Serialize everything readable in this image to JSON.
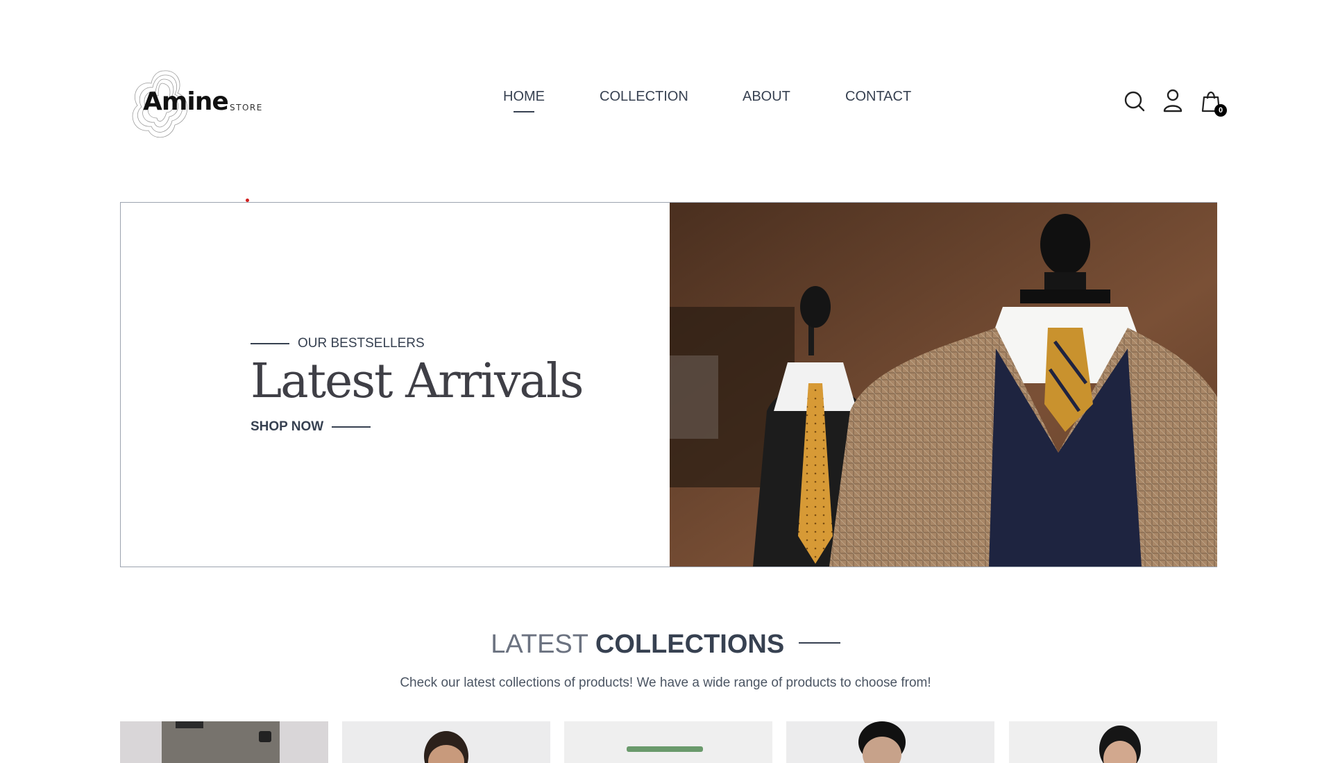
{
  "logo": {
    "wordmark": "Amine",
    "suffix": "STORE"
  },
  "nav": {
    "items": [
      {
        "label": "HOME",
        "active": true
      },
      {
        "label": "COLLECTION",
        "active": false
      },
      {
        "label": "ABOUT",
        "active": false
      },
      {
        "label": "CONTACT",
        "active": false
      }
    ]
  },
  "header_icons": {
    "search": "search-icon",
    "account": "user-icon",
    "cart": "shopping-bag-icon",
    "cart_count": "0"
  },
  "hero": {
    "eyebrow": "OUR BESTSELLERS",
    "title": "Latest Arrivals",
    "cta": "SHOP NOW",
    "image": "mannequins-suits-ties-photo"
  },
  "collections": {
    "title_light": "LATEST",
    "title_bold": "COLLECTIONS",
    "subtitle": "Check our latest collections of products! We have a wide range of products to choose from!",
    "products": [
      {
        "image": "product-photo-pants"
      },
      {
        "image": "product-photo-man"
      },
      {
        "image": "product-photo-green-item"
      },
      {
        "image": "product-photo-man"
      },
      {
        "image": "product-photo-woman"
      }
    ]
  },
  "colors": {
    "text": "#374151",
    "muted": "#6b7280",
    "border": "#9ca3af",
    "accent_dot": "#d21f1f"
  }
}
